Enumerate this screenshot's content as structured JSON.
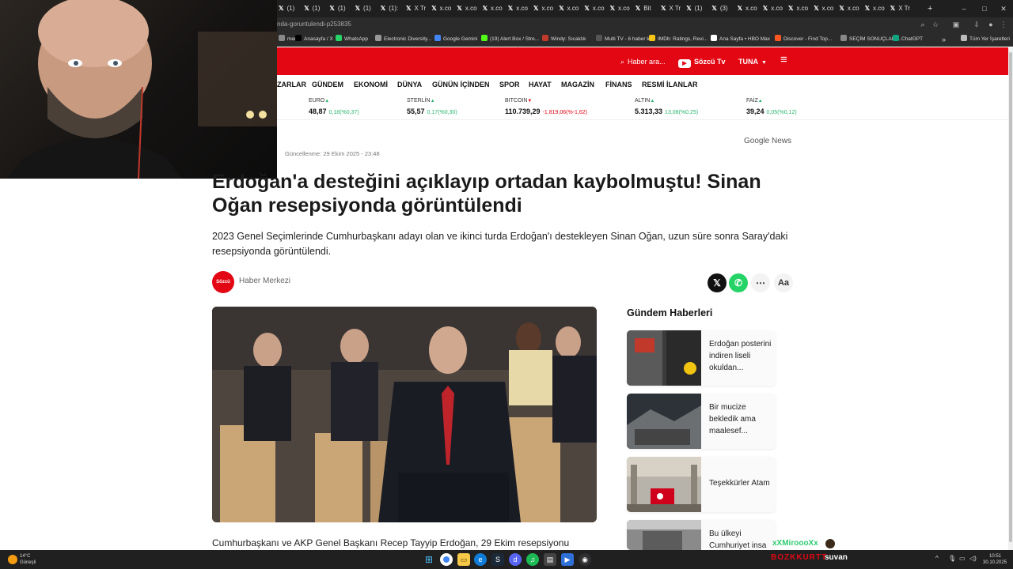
{
  "browser": {
    "tabs": [
      {
        "label": "(1)"
      },
      {
        "label": "(1)"
      },
      {
        "label": "(1)"
      },
      {
        "label": "(1)"
      },
      {
        "label": "(1):"
      },
      {
        "label": "X Tr"
      },
      {
        "label": "x.co"
      },
      {
        "label": "x.co"
      },
      {
        "label": "x.co"
      },
      {
        "label": "x.co"
      },
      {
        "label": "x.co"
      },
      {
        "label": "x.co"
      },
      {
        "label": "x.co"
      },
      {
        "label": "x.co"
      },
      {
        "label": "Bit"
      },
      {
        "label": "X Tr"
      },
      {
        "label": "(1)"
      },
      {
        "label": "(3)"
      },
      {
        "label": "x.co"
      },
      {
        "label": "x.co"
      },
      {
        "label": "x.co"
      },
      {
        "label": "x.co"
      },
      {
        "label": "x.co"
      },
      {
        "label": "x.co"
      },
      {
        "label": "X Tr"
      }
    ],
    "new_tab": "+",
    "url": "nda-goruntulendi-p253835",
    "bookmarks": [
      {
        "label": "mers",
        "color": "#888"
      },
      {
        "label": "Anasayfa / X",
        "color": "#000"
      },
      {
        "label": "WhatsApp",
        "color": "#25d366"
      },
      {
        "label": "Electronic Diversity...",
        "color": "#999"
      },
      {
        "label": "Google Gemini",
        "color": "#4285f4"
      },
      {
        "label": "(19) Alert Box / Stre...",
        "color": "#53fc18"
      },
      {
        "label": "Windy: Sıcaklık",
        "color": "#c0392b"
      },
      {
        "label": "Multi TV - 6 haber k...",
        "color": "#555"
      },
      {
        "label": "IMDb: Ratings, Revi...",
        "color": "#f5c518"
      },
      {
        "label": "Ana Sayfa • HBO Max",
        "color": "#fff"
      },
      {
        "label": "Discover - Find Top...",
        "color": "#ff5722"
      },
      {
        "label": "SEÇİM SONUÇLARI...",
        "color": "#888"
      },
      {
        "label": "ChatGPT",
        "color": "#10a37f"
      }
    ],
    "bookmarks_more": "»",
    "all_bookmarks": "Tüm Yer İşaretleri"
  },
  "site": {
    "search_placeholder": "Haber ara...",
    "tv_label": "Sözcü Tv",
    "user_label": "TUNA",
    "nav": [
      "ZARLAR",
      "GÜNDEM",
      "EKONOMİ",
      "DÜNYA",
      "GÜNÜN İÇİNDEN",
      "SPOR",
      "HAYAT",
      "MAGAZİN",
      "FİNANS",
      "RESMİ İLANLAR"
    ],
    "ticker": [
      {
        "label": "EURO",
        "dir": "up",
        "value": "48,87",
        "change": "0,18(%0,37)"
      },
      {
        "label": "STERLİN",
        "dir": "up",
        "value": "55,57",
        "change": "0,17(%0,30)"
      },
      {
        "label": "BITCOIN",
        "dir": "down",
        "value": "110.739,29",
        "change": "-1.819,06(%-1,62)"
      },
      {
        "label": "ALTIN",
        "dir": "up",
        "value": "5.313,33",
        "change": "13,08(%0,25)"
      },
      {
        "label": "FAİZ",
        "dir": "up",
        "value": "39,24",
        "change": "0,05(%0,12)"
      }
    ]
  },
  "article": {
    "updated": "Güncellenme: 29 Ekim 2025 - 23:48",
    "google_news": "Google News",
    "title": "Erdoğan'a desteğini açıklayıp ortadan kaybolmuştu! Sinan Oğan resepsiyonda görüntülendi",
    "lead": "2023 Genel Seçimlerinde Cumhurbaşkanı adayı olan ve ikinci turda Erdoğan'ı destekleyen Sinan Oğan, uzun süre sonra Saray'daki resepsiyonda görüntülendi.",
    "author_logo": "Sözcü",
    "author": "Haber Merkezi",
    "font_toggle": "Aa",
    "body_start": "Cumhurbaşkanı ve AKP Genel Başkanı Recep Tayyip Erdoğan, 29 Ekim resepsiyonu"
  },
  "sidebar": {
    "title": "Gündem Haberleri",
    "items": [
      {
        "text": "Erdoğan posterini indiren liseli okuldan..."
      },
      {
        "text": "Bir mucize bekledik ama maalesef..."
      },
      {
        "text": "Teşekkürler Atam"
      },
      {
        "text": "Bu ülkeyi Cumhuriyet insa"
      }
    ]
  },
  "overlay": {
    "chat_name": "xXMiroooXx",
    "streamer_tag": "BOZKKURTT",
    "streamer_sub": "suvan"
  },
  "taskbar": {
    "weather_temp": "14°C",
    "weather_desc": "Güneşli",
    "time": "10:51",
    "date": "30.10.2025"
  }
}
